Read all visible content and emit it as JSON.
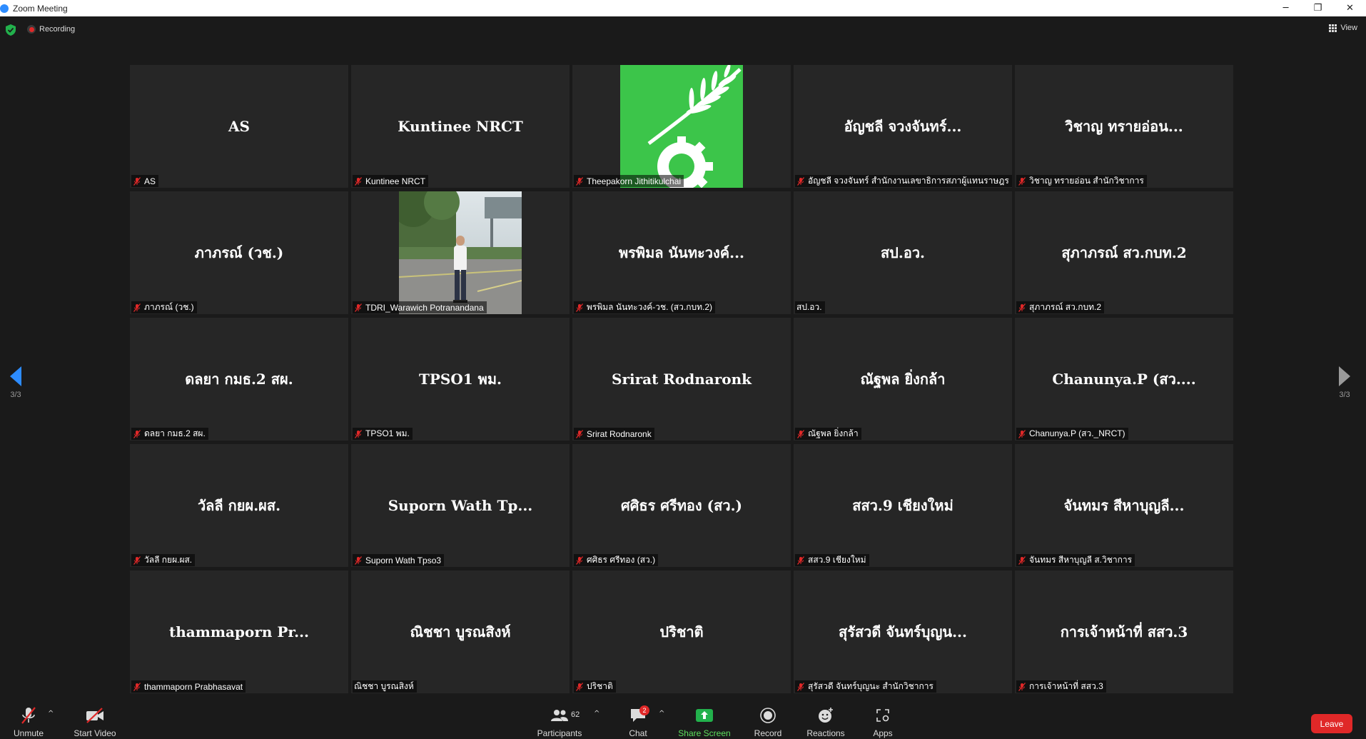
{
  "window": {
    "title": "Zoom Meeting",
    "minimize": "─",
    "restore": "❐",
    "close": "✕"
  },
  "topbar": {
    "recording_label": "Recording",
    "view_label": "View"
  },
  "pagination": {
    "left": "3/3",
    "right": "3/3"
  },
  "participants": [
    {
      "display": "AS",
      "label": "AS",
      "muted": true,
      "video": false
    },
    {
      "display": "Kuntinee NRCT",
      "label": "Kuntinee NRCT",
      "muted": true,
      "video": false
    },
    {
      "display": "",
      "label": "Theepakorn Jithitikulchai",
      "muted": true,
      "video": true,
      "video_kind": "logo"
    },
    {
      "display": "อัญชลี  จวงจันทร์...",
      "label": "อัญชลี  จวงจันทร์ สำนักงานเลขาธิการสภาผู้แทนราษฎร",
      "muted": true,
      "video": false
    },
    {
      "display": "วิชาญ ทรายอ่อน...",
      "label": "วิชาญ ทรายอ่อน สำนักวิชาการ",
      "muted": true,
      "video": false
    },
    {
      "display": "ภาภรณ์ (วช.)",
      "label": "ภาภรณ์ (วช.)",
      "muted": true,
      "video": false
    },
    {
      "display": "",
      "label": "TDRI_Warawich Potranandana",
      "muted": true,
      "video": true,
      "video_kind": "photo"
    },
    {
      "display": "พรพิมล นันทะวงค์...",
      "label": "พรพิมล นันทะวงค์-วช. (สว.กบท.2)",
      "muted": true,
      "video": false
    },
    {
      "display": "สป.อว.",
      "label": "สป.อว.",
      "muted": false,
      "video": false
    },
    {
      "display": "สุภาภรณ์ สว.กบท.2",
      "label": "สุภาภรณ์ สว.กบท.2",
      "muted": true,
      "video": false
    },
    {
      "display": "ดลยา กมธ.2 สผ.",
      "label": "ดลยา กมธ.2 สผ.",
      "muted": true,
      "video": false
    },
    {
      "display": "TPSO1 พม.",
      "label": "TPSO1 พม.",
      "muted": true,
      "video": false
    },
    {
      "display": "Srirat Rodnaronk",
      "label": "Srirat Rodnaronk",
      "muted": true,
      "video": false
    },
    {
      "display": "ณัฐพล ยิ่งกล้า",
      "label": "ณัฐพล ยิ่งกล้า",
      "muted": true,
      "video": false
    },
    {
      "display": "Chanunya.P  (สว....",
      "label": "Chanunya.P (สว._NRCT)",
      "muted": true,
      "video": false
    },
    {
      "display": "วัลลี กยผ.ผส.",
      "label": "วัลลี กยผ.ผส.",
      "muted": true,
      "video": false
    },
    {
      "display": "Suporn Wath Tp...",
      "label": "Suporn Wath Tpso3",
      "muted": true,
      "video": false
    },
    {
      "display": "ศศิธร ศรีทอง (สว.)",
      "label": "ศศิธร ศรีทอง (สว.)",
      "muted": true,
      "video": false
    },
    {
      "display": "สสว.9 เชียงใหม่",
      "label": "สสว.9 เชียงใหม่",
      "muted": true,
      "video": false
    },
    {
      "display": "จันทมร  สีหาบุญลี...",
      "label": "จันทมร  สีหาบุญลี  ส.วิชาการ",
      "muted": true,
      "video": false
    },
    {
      "display": "thammaporn Pr...",
      "label": "thammaporn Prabhasavat",
      "muted": true,
      "video": false
    },
    {
      "display": "ณิชชา  บูรณสิงห์",
      "label": "ณิชชา  บูรณสิงห์",
      "muted": false,
      "video": false
    },
    {
      "display": "ปริชาติ",
      "label": "ปริชาติ",
      "muted": true,
      "video": false
    },
    {
      "display": "สุรัสวดี จันทร์บุญน...",
      "label": "สุรัสวดี จันทร์บุญนะ สำนักวิชาการ",
      "muted": true,
      "video": false
    },
    {
      "display": "การเจ้าหน้าที่ สสว.3",
      "label": "การเจ้าหน้าที่ สสว.3",
      "muted": true,
      "video": false
    }
  ],
  "toolbar": {
    "unmute": "Unmute",
    "start_video": "Start Video",
    "participants": "Participants",
    "participants_count": "62",
    "chat": "Chat",
    "chat_badge": "2",
    "share_screen": "Share Screen",
    "record": "Record",
    "reactions": "Reactions",
    "apps": "Apps",
    "leave": "Leave",
    "caret": "^"
  },
  "colors": {
    "background": "#1a1a1a",
    "tile": "#262626",
    "muted_red": "#e02828",
    "share_green": "#22b14c",
    "logo_green": "#3cc54a",
    "zoom_blue": "#2d8cff"
  }
}
